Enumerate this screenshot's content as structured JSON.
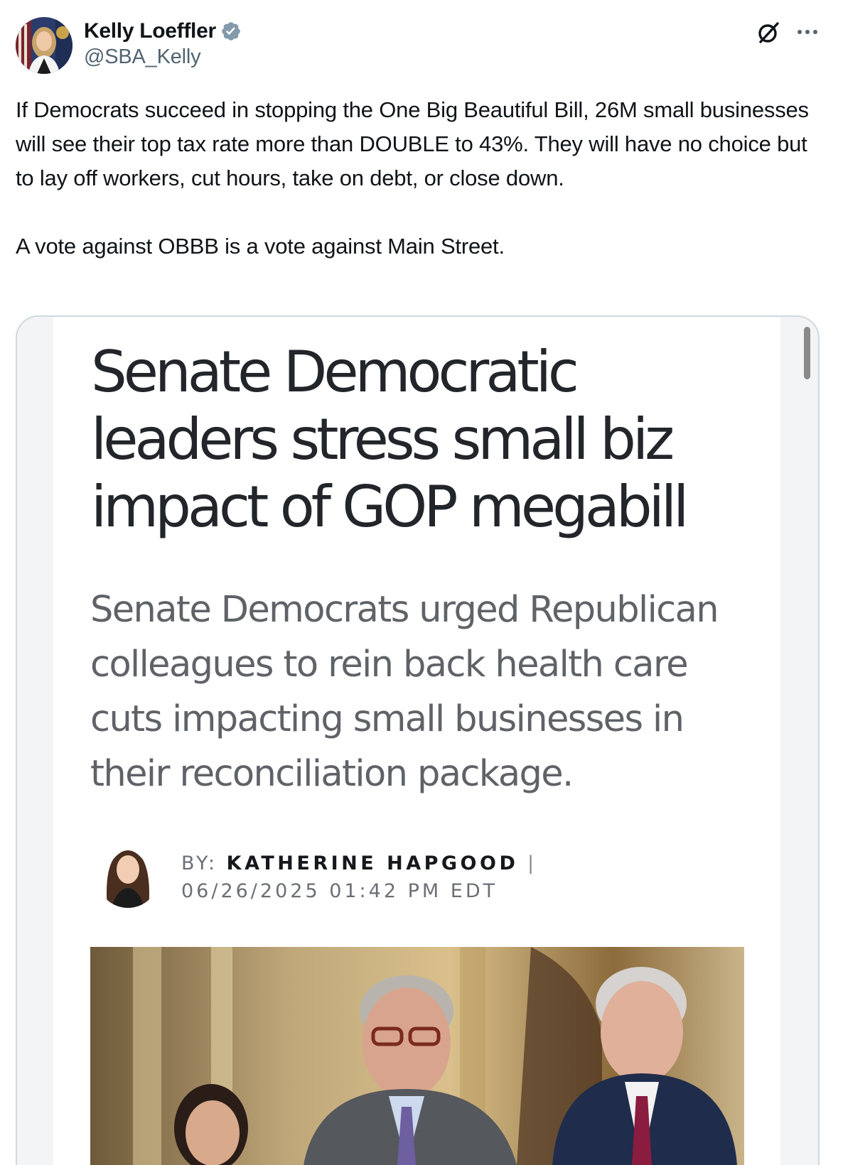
{
  "tweet": {
    "author": {
      "display_name": "Kelly Loeffler",
      "handle": "@SBA_Kelly",
      "verified": true
    },
    "paragraphs": [
      "If Democrats succeed in stopping the One Big Beautiful Bill, 26M small businesses will see their top tax rate more than DOUBLE to 43%. They will have no choice but to lay off workers, cut hours, take on debt, or close down.",
      "A vote against OBBB is a vote against Main Street."
    ]
  },
  "icons": {
    "verified": "verified-badge-icon",
    "grok": "grok-icon",
    "more": "more-options-icon"
  },
  "article": {
    "headline": "Senate Democratic leaders stress small biz impact of GOP megabill",
    "subhead": "Senate Democrats urged Republican colleagues to rein back health care cuts impacting small businesses in their reconciliation package.",
    "byline_prefix": "BY:",
    "author": "KATHERINE HAPGOOD",
    "separator": "|",
    "timestamp": "06/26/2025 01:42 PM EDT"
  },
  "colors": {
    "verified_blue": "#829aab",
    "text_primary": "#0f1419",
    "text_secondary": "#536471",
    "card_border": "#cfd9de"
  }
}
